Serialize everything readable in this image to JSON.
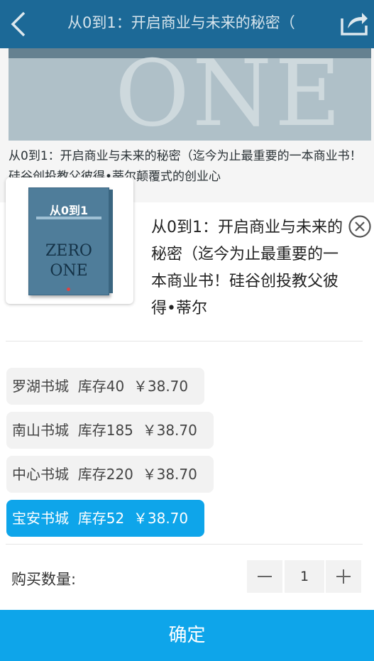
{
  "header": {
    "title": "从0到1：开启商业与未来的秘密（"
  },
  "background": {
    "banner_text": "ONE",
    "description": "从0到1：开启商业与未来的秘密（迄今为止最重要的一本商业书！硅谷创投教父彼得•蒂尔颠覆式的创业心"
  },
  "product": {
    "title": "从0到1：开启商业与未来的秘密（迄今为止最重要的一本商业书！硅谷创投教父彼得•蒂尔",
    "cover_cn": "从0到1",
    "cover_zero": "ZERO",
    "cover_one": "ONE"
  },
  "stores": [
    {
      "label": "罗湖书城  库存40  ￥38.70",
      "selected": false
    },
    {
      "label": "南山书城  库存185  ￥38.70",
      "selected": false
    },
    {
      "label": "中心书城  库存220  ￥38.70",
      "selected": false
    },
    {
      "label": "宝安书城  库存52  ￥38.70",
      "selected": true
    }
  ],
  "quantity": {
    "label": "购买数量:",
    "value": "1"
  },
  "confirm_label": "确定",
  "colors": {
    "header": "#1e6e9e",
    "accent": "#0ea5ea"
  }
}
